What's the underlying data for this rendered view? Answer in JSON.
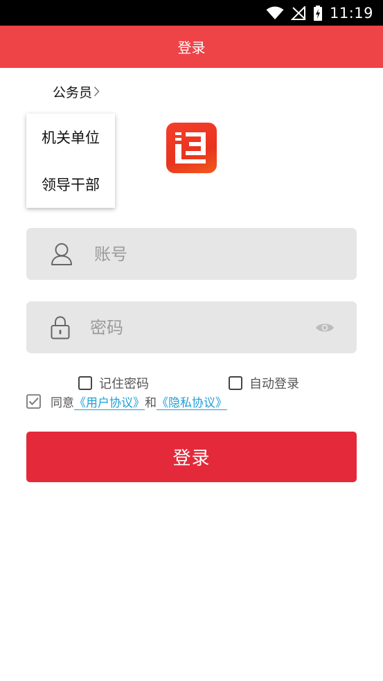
{
  "status_bar": {
    "time": "11:19",
    "icons": [
      "wifi-icon",
      "no-signal-icon",
      "battery-charging-icon"
    ]
  },
  "header": {
    "title": "登录"
  },
  "role_selector": {
    "label": "公务员",
    "icon": "chevron-right-icon",
    "options": [
      "机关单位",
      "领导干部"
    ]
  },
  "logo": {
    "icon": "app-logo-icon"
  },
  "account_field": {
    "placeholder": "账号",
    "value": "",
    "icon": "user-icon"
  },
  "password_field": {
    "placeholder": "密码",
    "value": "",
    "icon": "lock-icon",
    "toggle_icon": "eye-icon"
  },
  "options": {
    "remember_password": {
      "label": "记住密码",
      "checked": false
    },
    "auto_login": {
      "label": "自动登录",
      "checked": false
    }
  },
  "agreement": {
    "checked": true,
    "prefix": "同意",
    "user_agreement": "《用户协议》",
    "connector": "和",
    "privacy_policy": "《隐私协议》"
  },
  "login_button": {
    "label": "登录"
  },
  "colors": {
    "header": "#ee4347",
    "login_button": "#e4293a",
    "link": "#1e9fd8",
    "field_bg": "#e6e6e6"
  }
}
